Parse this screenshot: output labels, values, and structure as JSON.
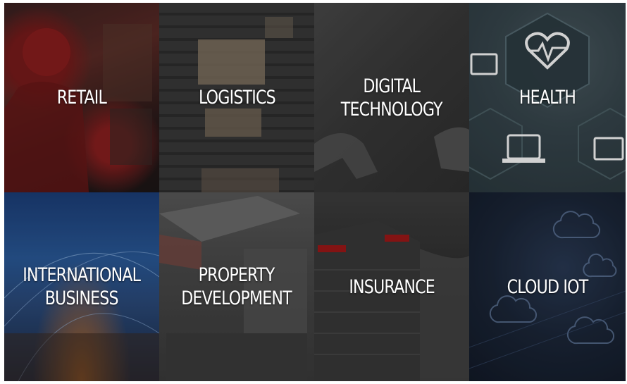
{
  "tiles": [
    {
      "id": "retail",
      "label": "RETAIL"
    },
    {
      "id": "logistics",
      "label": "LOGISTICS"
    },
    {
      "id": "digital-technology",
      "label": "DIGITAL\nTECHNOLOGY"
    },
    {
      "id": "health",
      "label": "HEALTH"
    },
    {
      "id": "international-business",
      "label": "INTERNATIONAL\nBUSINESS"
    },
    {
      "id": "property-development",
      "label": "PROPERTY\nDEVELOPMENT"
    },
    {
      "id": "insurance",
      "label": "INSURANCE"
    },
    {
      "id": "cloud-iot",
      "label": "CLOUD IOT"
    }
  ],
  "icons": {
    "health": "heart-monitor-icon",
    "cloud": "cloud-icon"
  }
}
